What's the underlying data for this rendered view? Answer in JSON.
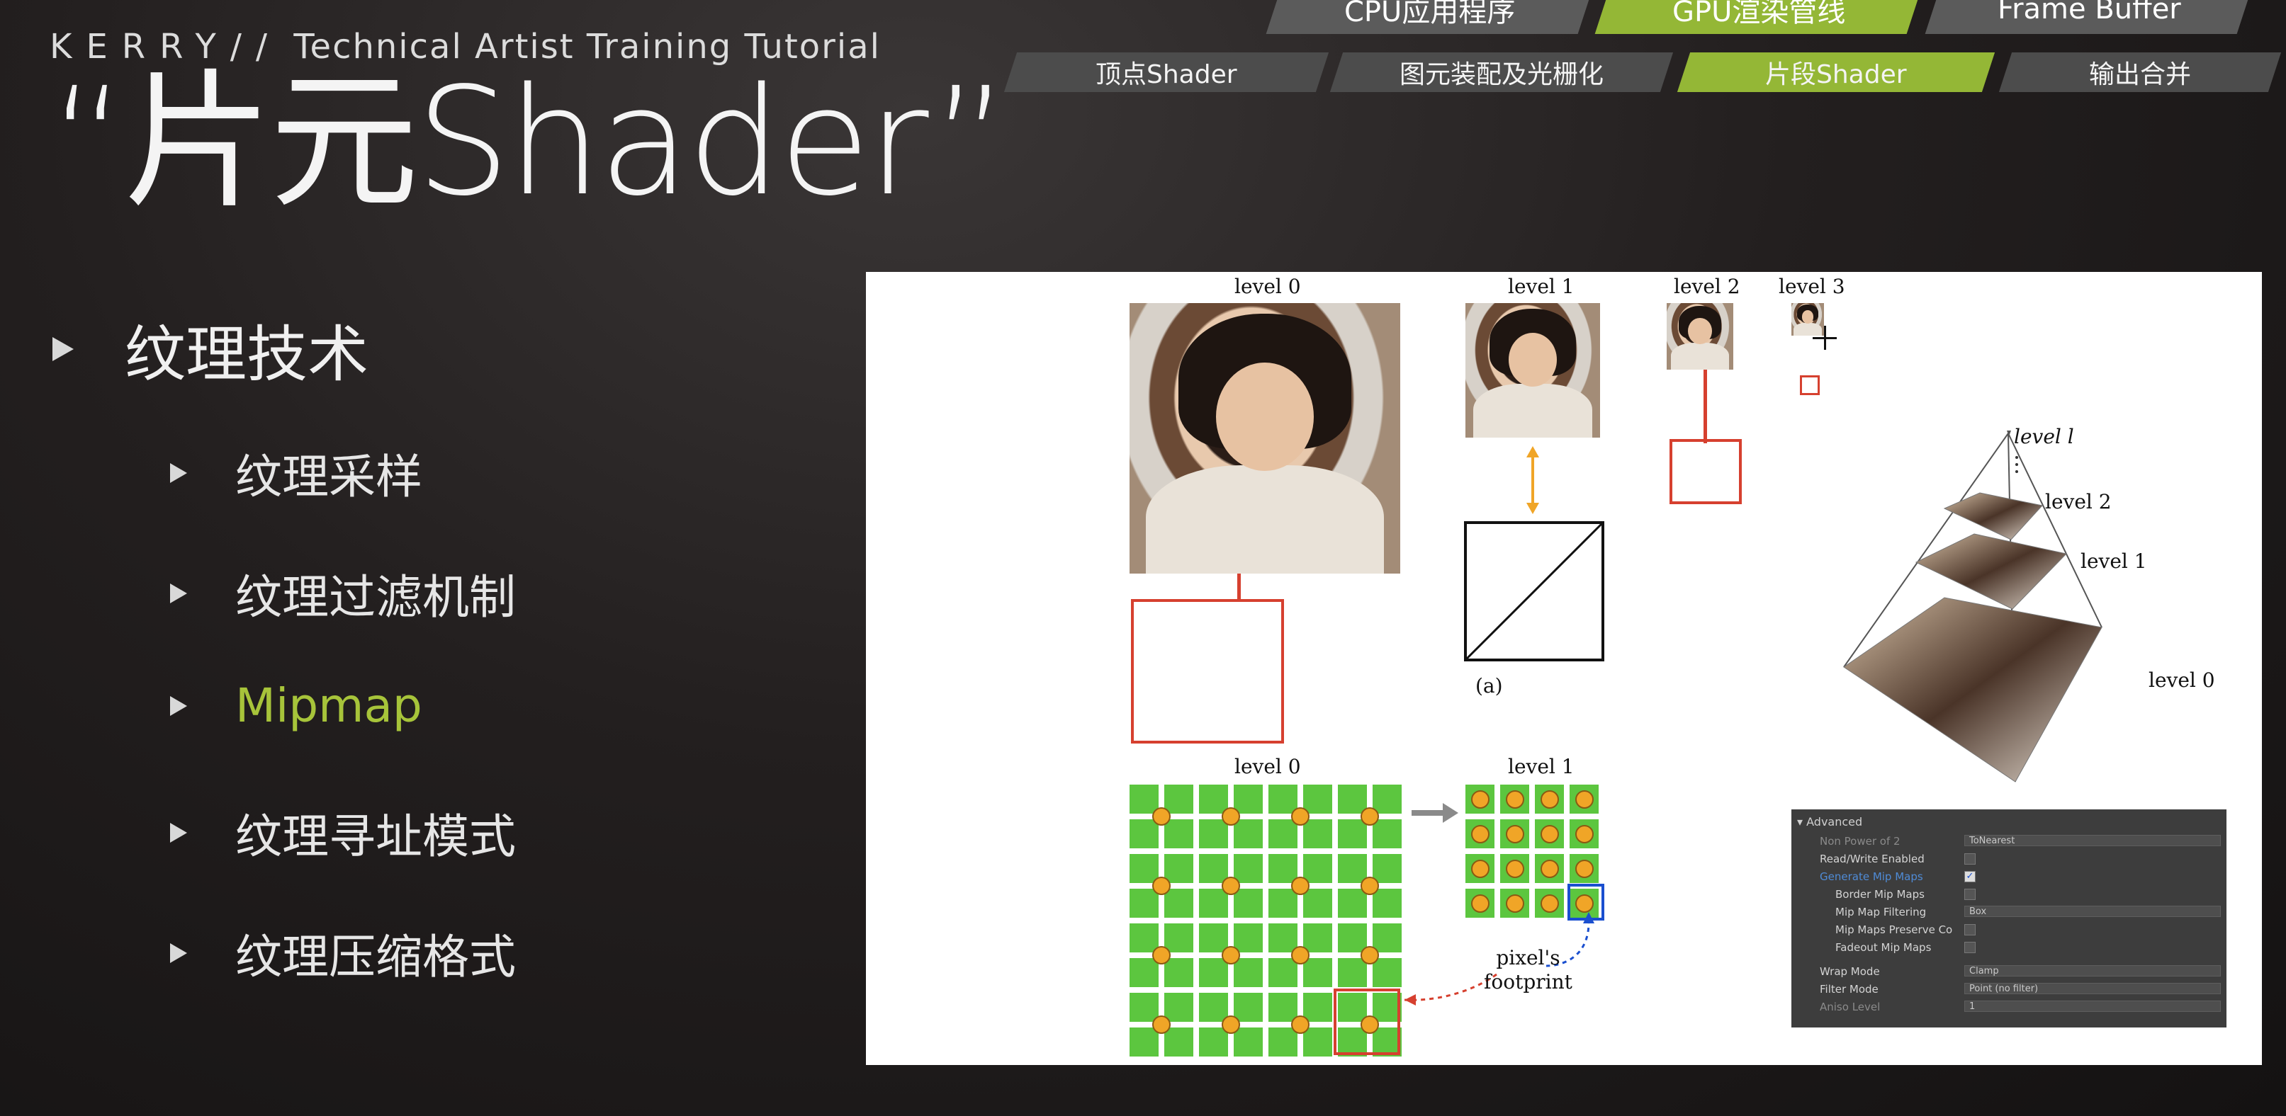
{
  "header": {
    "brand_prefix": "KERRY//",
    "brand_text": "Technical Artist Training Tutorial",
    "title": "“片元Shader”"
  },
  "pipeline": {
    "tabs": [
      {
        "label": "CPU应用程序",
        "active": false
      },
      {
        "label": "GPU渲染管线",
        "active": true
      },
      {
        "label": "Frame Buffer",
        "active": false
      }
    ],
    "subtabs": [
      {
        "label": "顶点Shader",
        "active": false
      },
      {
        "label": "图元装配及光栅化",
        "active": false
      },
      {
        "label": "片段Shader",
        "active": true
      },
      {
        "label": "输出合并",
        "active": false
      }
    ]
  },
  "menu": {
    "section": "纹理技术",
    "items": [
      {
        "label": "纹理采样",
        "active": false
      },
      {
        "label": "纹理过滤机制",
        "active": false
      },
      {
        "label": "Mipmap",
        "active": true
      },
      {
        "label": "纹理寻址模式",
        "active": false
      },
      {
        "label": "纹理压缩格式",
        "active": false
      }
    ]
  },
  "figure": {
    "level0": "level 0",
    "level1": "level 1",
    "level2": "level 2",
    "level3": "level 3",
    "caption_a": "(a)",
    "pyramid_levels": [
      "level l",
      "level 2",
      "level 1",
      "level 0"
    ],
    "grid_level0": "level 0",
    "grid_level1": "level 1",
    "footprint_line1": "pixel's",
    "footprint_line2": "footprint"
  },
  "unity_panel": {
    "header": "Advanced",
    "rows": [
      {
        "label": "Non Power of 2",
        "value": "ToNearest",
        "kind": "dropdown",
        "state": "dim"
      },
      {
        "label": "Read/Write Enabled",
        "kind": "checkbox",
        "checked": false,
        "state": "normal"
      },
      {
        "label": "Generate Mip Maps",
        "kind": "checkbox",
        "checked": true,
        "state": "blue"
      },
      {
        "label": "Border Mip Maps",
        "kind": "checkbox",
        "checked": false,
        "state": "normal",
        "indent": true
      },
      {
        "label": "Mip Map Filtering",
        "value": "Box",
        "kind": "dropdown",
        "state": "normal",
        "indent": true
      },
      {
        "label": "Mip Maps Preserve Co",
        "kind": "checkbox",
        "checked": false,
        "state": "normal",
        "indent": true
      },
      {
        "label": "Fadeout Mip Maps",
        "kind": "checkbox",
        "checked": false,
        "state": "normal",
        "indent": true
      },
      {
        "label": "Wrap Mode",
        "value": "Clamp",
        "kind": "dropdown",
        "state": "normal"
      },
      {
        "label": "Filter Mode",
        "value": "Point (no filter)",
        "kind": "dropdown",
        "state": "normal"
      },
      {
        "label": "Aniso Level",
        "value": "1",
        "kind": "slider",
        "state": "dim"
      }
    ]
  },
  "colors": {
    "accent_green": "#94b736",
    "menu_active": "#a7c43a",
    "box_red": "#d6402f",
    "grid_green": "#5cc63f",
    "dot_orange": "#f0a527"
  }
}
